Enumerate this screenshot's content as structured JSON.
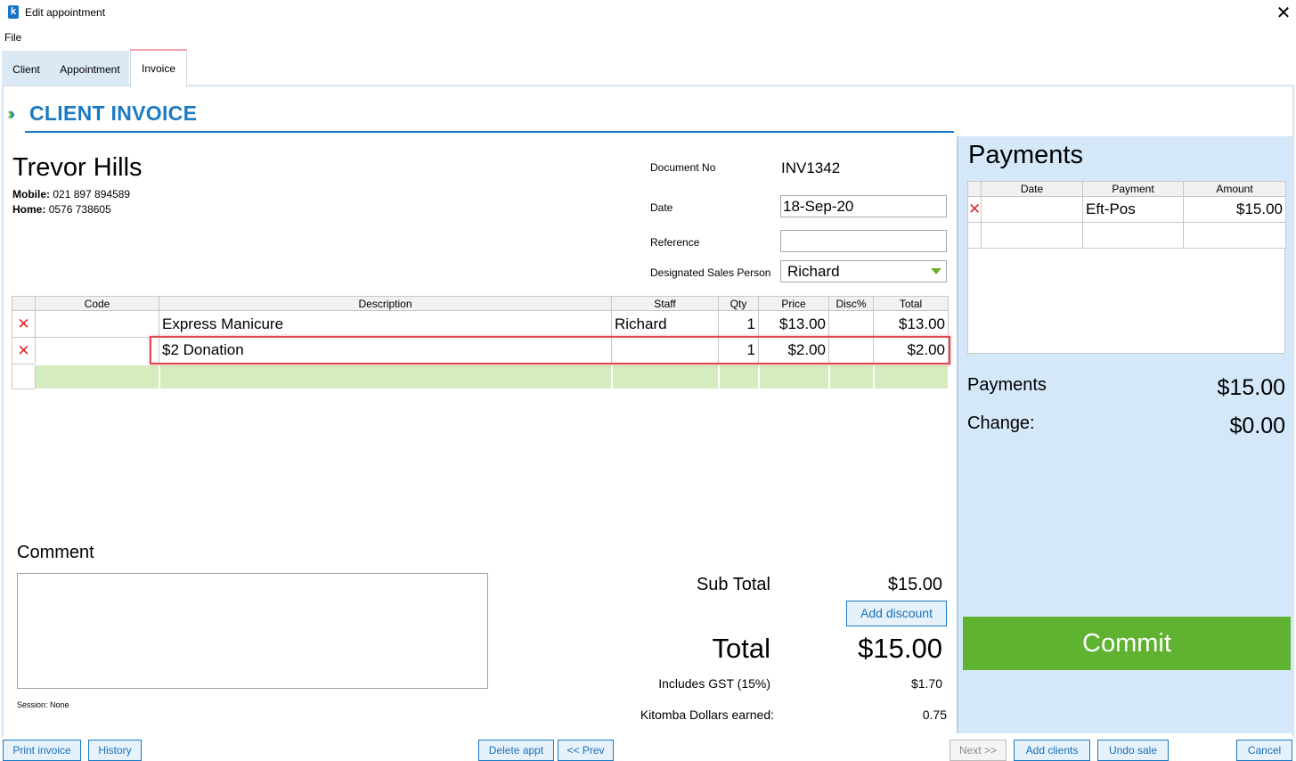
{
  "window": {
    "title": "Edit appointment",
    "logo_letter": "k",
    "close_glyph": "✕"
  },
  "menu": {
    "file": "File"
  },
  "tabs": [
    {
      "label": "Client"
    },
    {
      "label": "Appointment"
    },
    {
      "label": "Invoice"
    }
  ],
  "heading": {
    "chevrons": "»",
    "title": "CLIENT INVOICE"
  },
  "client": {
    "name": "Trevor Hills",
    "mobile_label": "Mobile:",
    "mobile": "021 897 894589",
    "home_label": "Home:",
    "home": "0576 738605"
  },
  "document": {
    "doc_no_label": "Document No",
    "doc_no": "INV1342",
    "date_label": "Date",
    "date": "18-Sep-20",
    "reference_label": "Reference",
    "reference": "",
    "sales_person_label": "Designated Sales Person",
    "sales_person": "Richard"
  },
  "items": {
    "columns": [
      "Code",
      "Description",
      "Staff",
      "Qty",
      "Price",
      "Disc%",
      "Total"
    ],
    "rows": [
      {
        "code": "",
        "description": "Express Manicure",
        "staff": "Richard",
        "qty": "1",
        "price": "$13.00",
        "disc": "",
        "total": "$13.00"
      },
      {
        "code": "",
        "description": "$2 Donation",
        "staff": "",
        "qty": "1",
        "price": "$2.00",
        "disc": "",
        "total": "$2.00"
      }
    ]
  },
  "comment": {
    "label": "Comment",
    "value": "",
    "session": "Session: None"
  },
  "totals": {
    "subtotal_label": "Sub Total",
    "subtotal": "$15.00",
    "add_discount": "Add discount",
    "total_label": "Total",
    "total": "$15.00",
    "gst_label": "Includes GST (15%)",
    "gst": "$1.70",
    "kd_label": "Kitomba Dollars earned:",
    "kd": "0.75"
  },
  "payments": {
    "title": "Payments",
    "columns": [
      "Date",
      "Payment",
      "Amount"
    ],
    "rows": [
      {
        "date": "",
        "payment": "Eft-Pos",
        "amount": "$15.00"
      }
    ],
    "payments_label": "Payments",
    "payments_value": "$15.00",
    "change_label": "Change:",
    "change_value": "$0.00",
    "commit": "Commit"
  },
  "footer": {
    "print_invoice": "Print invoice",
    "history": "History",
    "delete_appt": "Delete appt",
    "prev": "<< Prev",
    "next": "Next >>",
    "add_clients": "Add clients",
    "undo_sale": "Undo sale",
    "cancel": "Cancel"
  },
  "colors": {
    "accent": "#1b7ac4",
    "commit": "#5fb330",
    "panel": "#d5e8f9",
    "delete": "#e0262c",
    "new_row": "#d5ecbf"
  }
}
